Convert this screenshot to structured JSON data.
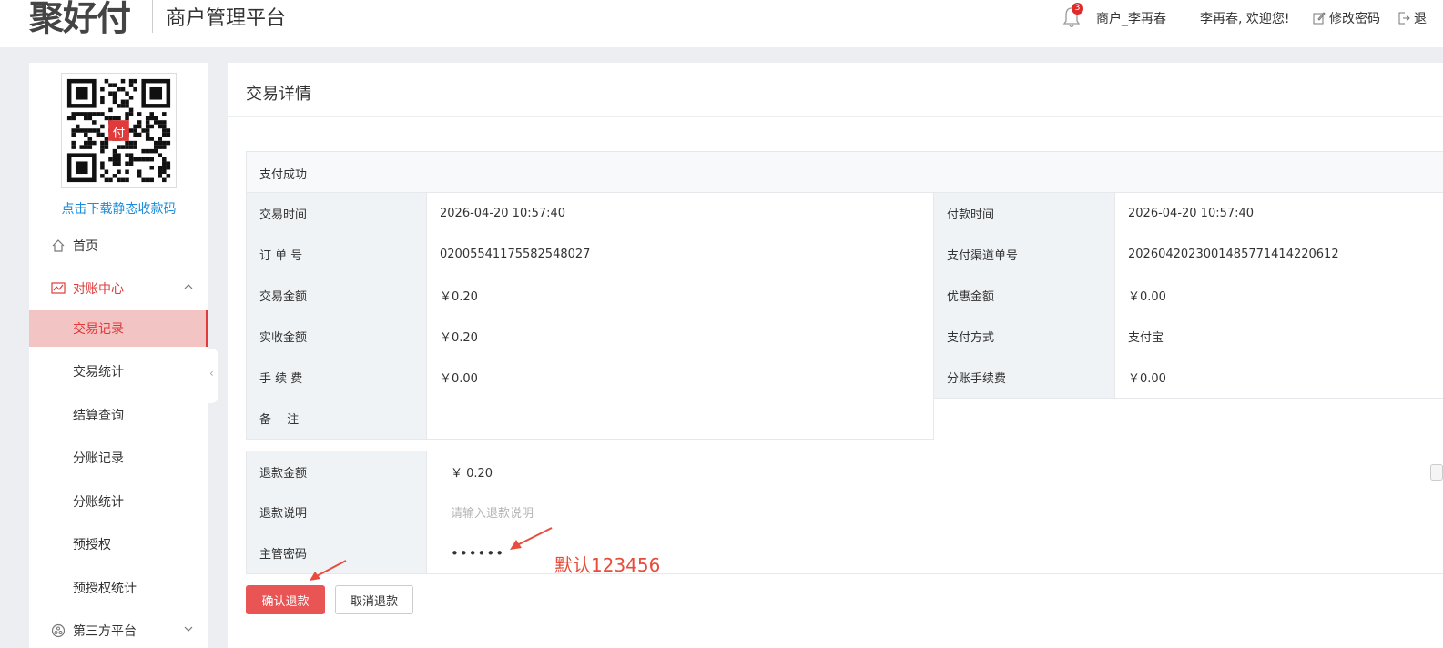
{
  "header": {
    "logo_text": "聚好付",
    "platform_title": "商户管理平台",
    "notification_count": "3",
    "merchant_name": "商户_李再春",
    "welcome": "李再春, 欢迎您!",
    "change_password": "修改密码",
    "logout": "退"
  },
  "sidebar": {
    "qr_link": "点击下载静态收款码",
    "home": "首页",
    "reconciliation": "对账中心",
    "sub_items": [
      "交易记录",
      "交易统计",
      "结算查询",
      "分账记录",
      "分账统计",
      "预授权",
      "预授权统计"
    ],
    "third_party": "第三方平台"
  },
  "main": {
    "title": "交易详情",
    "status": "支付成功",
    "rows": [
      {
        "l1": "交易时间",
        "v1": "2026-04-20 10:57:40",
        "l2": "付款时间",
        "v2": "2026-04-20 10:57:40"
      },
      {
        "l1": "订 单 号",
        "v1": "02005541175582548027",
        "l2": "支付渠道单号",
        "v2": "2026042023001485771414220612"
      },
      {
        "l1": "交易金额",
        "v1": "￥0.20",
        "l2": "优惠金额",
        "v2": "￥0.00"
      },
      {
        "l1": "实收金额",
        "v1": "￥0.20",
        "l2": "支付方式",
        "v2": "支付宝"
      },
      {
        "l1": "手 续 费",
        "v1": "￥0.00",
        "l2": "分账手续费",
        "v2": "￥0.00"
      },
      {
        "l1": "备 　注",
        "v1": ""
      }
    ],
    "refund": {
      "amount_label": "退款金额",
      "amount_value": "￥ 0.20",
      "desc_label": "退款说明",
      "desc_placeholder": "请输入退款说明",
      "pwd_label": "主管密码",
      "pwd_value": "••••••"
    },
    "confirm_button": "确认退款",
    "cancel_button": "取消退款",
    "annotation": "默认123456"
  },
  "colors": {
    "accent": "#e03a3a",
    "button": "#e95454",
    "link": "#1a8cdb"
  }
}
